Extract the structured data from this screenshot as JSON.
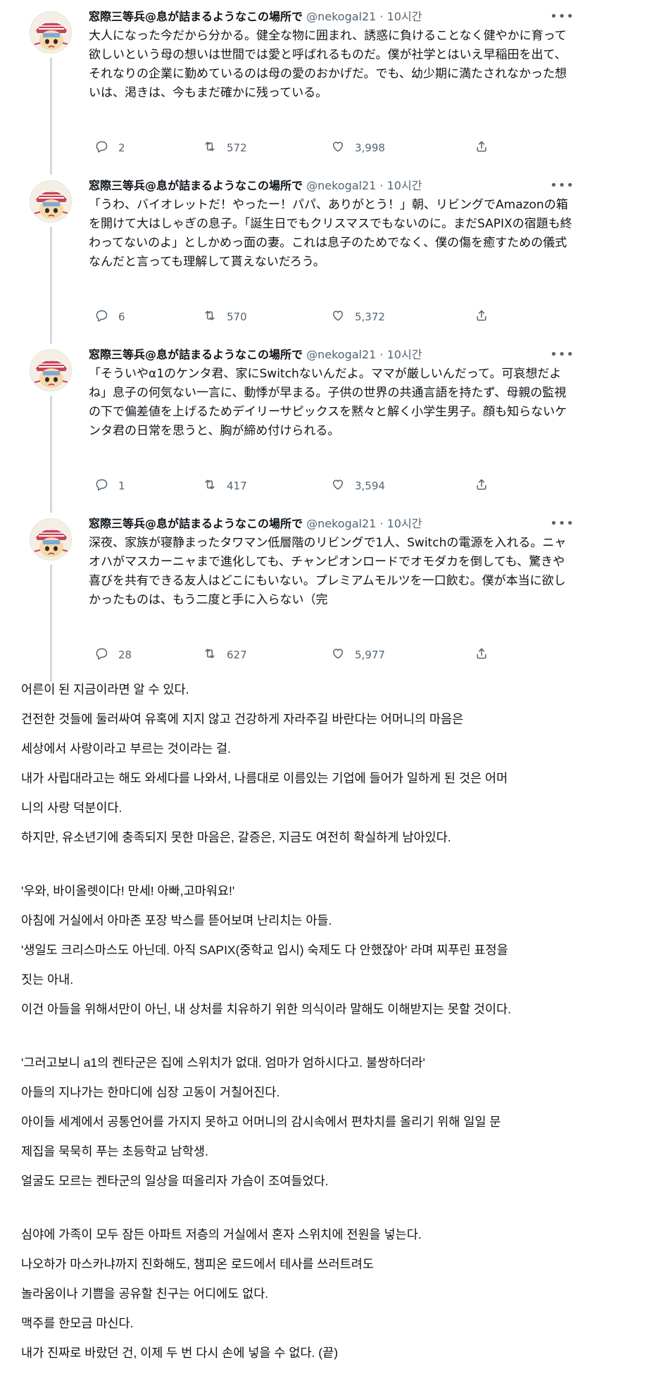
{
  "tweets": [
    {
      "name": "窓際三等兵@息が詰まるようなこの場所で",
      "handle": "@nekogal21",
      "time": "10시간",
      "text": "大人になった今だから分かる。健全な物に囲まれ、誘惑に負けることなく健やかに育って欲しいという母の想いは世間では愛と呼ばれるものだ。僕が社学とはいえ早稲田を出て、それなりの企業に勤めているのは母の愛のおかげだ。でも、幼少期に満たされなかった想いは、渇きは、今もまだ確かに残っている。",
      "replies": "2",
      "retweets": "572",
      "likes": "3,998"
    },
    {
      "name": "窓際三等兵@息が詰まるようなこの場所で",
      "handle": "@nekogal21",
      "time": "10시간",
      "text": "「うわ、バイオレットだ！やったー！パパ、ありがとう！」朝、リビングでAmazonの箱を開けて大はしゃぎの息子。「誕生日でもクリスマスでもないのに。まだSAPIXの宿題も終わってないのよ」としかめっ面の妻。これは息子のためでなく、僕の傷を癒すための儀式なんだと言っても理解して貰えないだろう。",
      "replies": "6",
      "retweets": "570",
      "likes": "5,372"
    },
    {
      "name": "窓際三等兵@息が詰まるようなこの場所で",
      "handle": "@nekogal21",
      "time": "10시간",
      "text": "「そういやα1のケンタ君、家にSwitchないんだよ。ママが厳しいんだって。可哀想だよね」息子の何気ない一言に、動悸が早まる。子供の世界の共通言語を持たず、母親の監視の下で偏差値を上げるためデイリーサピックスを黙々と解く小学生男子。顔も知らないケンタ君の日常を思うと、胸が締め付けられる。",
      "replies": "1",
      "retweets": "417",
      "likes": "3,594"
    },
    {
      "name": "窓際三等兵@息が詰まるようなこの場所で",
      "handle": "@nekogal21",
      "time": "10시간",
      "text": "深夜、家族が寝静まったタワマン低層階のリビングで1人、Switchの電源を入れる。ニャオハがマスカーニャまで進化しても、チャンピオンロードでオモダカを倒しても、驚きや喜びを共有できる友人はどこにもいない。プレミアムモルツを一口飲む。僕が本当に欲しかったものは、もう二度と手に入らない（完",
      "replies": "28",
      "retweets": "627",
      "likes": "5,977"
    }
  ],
  "translation": [
    "어른이 된 지금이라면 알 수 있다.",
    "건전한 것들에 둘러싸여 유혹에 지지 않고 건강하게 자라주길 바란다는 어머니의 마음은",
    "세상에서 사랑이라고 부르는 것이라는 걸.",
    "내가 사립대라고는 해도 와세다를 나와서, 나름대로 이름있는 기업에 들어가 일하게 된 것은 어머",
    "니의 사랑 덕분이다.",
    "하지만, 유소년기에 충족되지 못한 마음은, 갈증은, 지금도 여전히 확실하게 남아있다.",
    "",
    "'우와, 바이올렛이다! 만세! 아빠,고마워요!'",
    "아침에 거실에서 아마존 포장 박스를 뜯어보며 난리치는 아들.",
    "'생일도 크리스마스도 아닌데. 아직 SAPIX(중학교 입시) 숙제도 다 안했잖아' 라며 찌푸린 표정을",
    "짓는 아내.",
    "이건 아들을 위해서만이 아닌, 내 상처를 치유하기 위한 의식이라 말해도 이해받지는 못할 것이다.",
    "",
    "'그러고보니 a1의 켄타군은 집에 스위치가 없대. 엄마가 엄하시다고. 불쌍하더라'",
    "아들의 지나가는 한마디에 심장 고동이 거칠어진다.",
    "아이들 세계에서 공통언어를 가지지 못하고 어머니의 감시속에서 편차치를 올리기 위해 일일 문",
    "제집을 묵묵히 푸는 초등학교 남학생.",
    "얼굴도 모르는 켄타군의 일상을 떠올리자 가슴이 조여들었다.",
    "",
    "심야에 가족이 모두 잠든 아파트 저층의 거실에서 혼자 스위치에 전원을 넣는다.",
    "나오하가 마스카냐까지 진화해도, 챔피온 로드에서 테사를 쓰러트려도",
    "놀라움이나 기쁨을 공유할 친구는 어디에도 없다.",
    "맥주를 한모금 마신다.",
    "내가 진짜로 바랐던 건, 이제 두 번 다시 손에 넣을 수 없다. (끝)"
  ],
  "icons": {
    "reply": "reply-icon",
    "retweet": "retweet-icon",
    "like": "like-icon",
    "share": "share-icon",
    "more": "more-icon"
  },
  "colors": {
    "text": "#0f1419",
    "muted": "#536471",
    "thread_line": "#cfd9de"
  }
}
